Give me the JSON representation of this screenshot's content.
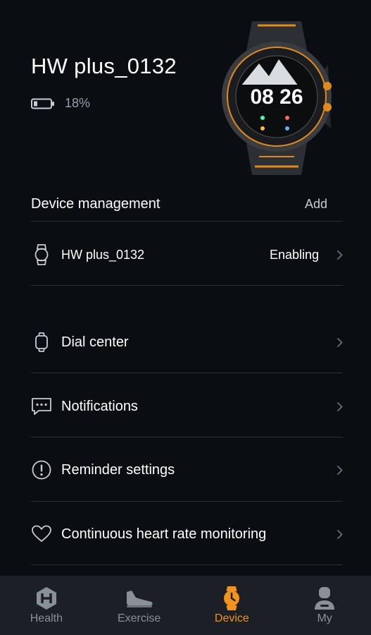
{
  "device": {
    "name": "HW plus_0132",
    "battery": "18%",
    "watch_time": "08 26"
  },
  "device_management": {
    "title": "Device management",
    "add_label": "Add"
  },
  "paired_device": {
    "name": "HW plus_0132",
    "status": "Enabling"
  },
  "menu": {
    "items": [
      {
        "label": "Dial center",
        "icon": "watch-icon"
      },
      {
        "label": "Notifications",
        "icon": "message-icon"
      },
      {
        "label": "Reminder settings",
        "icon": "alert-icon"
      },
      {
        "label": "Continuous heart rate monitoring",
        "icon": "heart-icon"
      }
    ]
  },
  "tabs": [
    {
      "label": "Health",
      "icon": "health-icon",
      "active": false
    },
    {
      "label": "Exercise",
      "icon": "shoe-icon",
      "active": false
    },
    {
      "label": "Device",
      "icon": "watch-icon",
      "active": true
    },
    {
      "label": "My",
      "icon": "person-icon",
      "active": false
    }
  ],
  "colors": {
    "background": "#0a0d12",
    "accent": "#f2931c",
    "tabbar": "#1c2026",
    "divider": "#2a2f36"
  }
}
